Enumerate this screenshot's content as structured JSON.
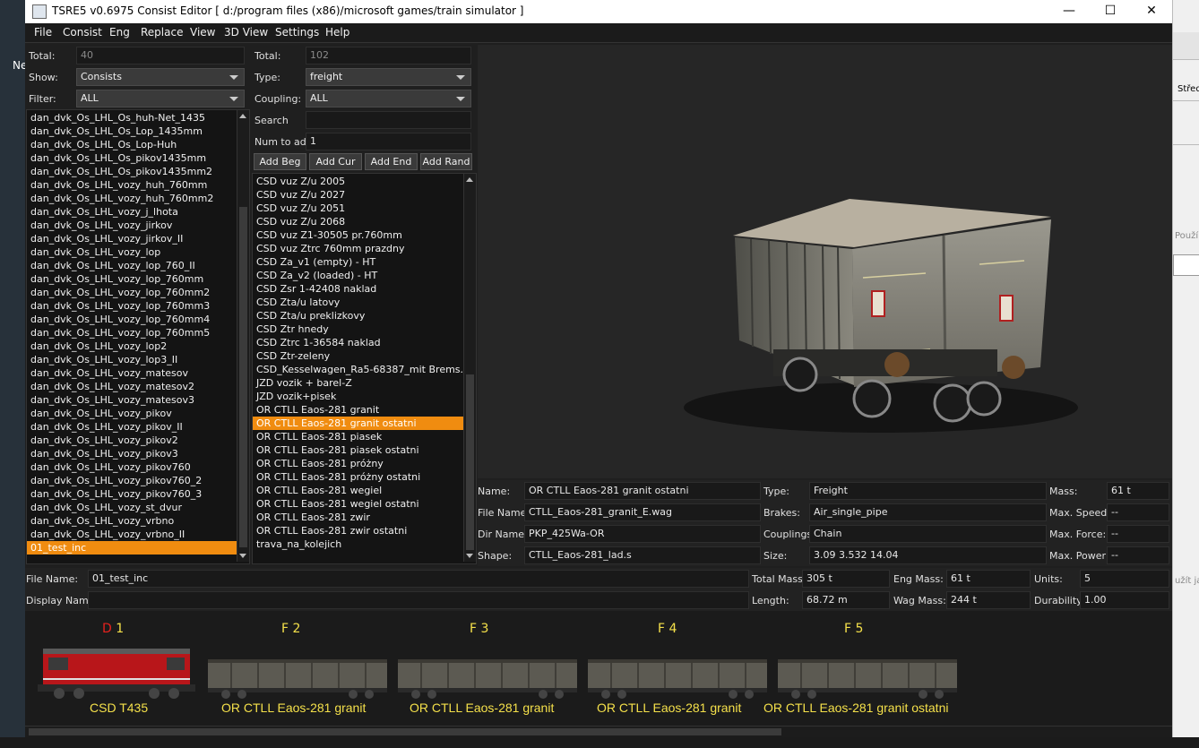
{
  "window": {
    "title": "TSRE5 v0.6975 Consist Editor   [ d:/program files (x86)/microsoft games/train simulator ]",
    "minimize": "—",
    "maximize": "☐",
    "close": "✕"
  },
  "menu": [
    "File",
    "Consist",
    "Eng",
    "Replace",
    "View",
    "3D View",
    "Settings",
    "Help"
  ],
  "left_panel": {
    "total_label": "Total:",
    "total_value": "40",
    "show_label": "Show:",
    "show_value": "Consists",
    "filter_label": "Filter:",
    "filter_value": "ALL",
    "items": [
      "dan_dvk_Os_LHL_Os_huh-Net_1435",
      "dan_dvk_Os_LHL_Os_Lop_1435mm",
      "dan_dvk_Os_LHL_Os_Lop-Huh",
      "dan_dvk_Os_LHL_Os_pikov1435mm",
      "dan_dvk_Os_LHL_Os_pikov1435mm2",
      "dan_dvk_Os_LHL_vozy_huh_760mm",
      "dan_dvk_Os_LHL_vozy_huh_760mm2",
      "dan_dvk_Os_LHL_vozy_j_lhota",
      "dan_dvk_Os_LHL_vozy_jirkov",
      "dan_dvk_Os_LHL_vozy_jirkov_II",
      "dan_dvk_Os_LHL_vozy_lop",
      "dan_dvk_Os_LHL_vozy_lop_760_II",
      "dan_dvk_Os_LHL_vozy_lop_760mm",
      "dan_dvk_Os_LHL_vozy_lop_760mm2",
      "dan_dvk_Os_LHL_vozy_lop_760mm3",
      "dan_dvk_Os_LHL_vozy_lop_760mm4",
      "dan_dvk_Os_LHL_vozy_lop_760mm5",
      "dan_dvk_Os_LHL_vozy_lop2",
      "dan_dvk_Os_LHL_vozy_lop3_II",
      "dan_dvk_Os_LHL_vozy_matesov",
      "dan_dvk_Os_LHL_vozy_matesov2",
      "dan_dvk_Os_LHL_vozy_matesov3",
      "dan_dvk_Os_LHL_vozy_pikov",
      "dan_dvk_Os_LHL_vozy_pikov_II",
      "dan_dvk_Os_LHL_vozy_pikov2",
      "dan_dvk_Os_LHL_vozy_pikov3",
      "dan_dvk_Os_LHL_vozy_pikov760",
      "dan_dvk_Os_LHL_vozy_pikov760_2",
      "dan_dvk_Os_LHL_vozy_pikov760_3",
      "dan_dvk_Os_LHL_vozy_st_dvur",
      "dan_dvk_Os_LHL_vozy_vrbno",
      "dan_dvk_Os_LHL_vozy_vrbno_II",
      "01_test_inc"
    ],
    "selected": "01_test_inc"
  },
  "mid_panel": {
    "total_label": "Total:",
    "total_value": "102",
    "type_label": "Type:",
    "type_value": "freight",
    "coupling_label": "Coupling:",
    "coupling_value": "ALL",
    "search_label": "Search",
    "search_value": "",
    "num_label": "Num to add",
    "num_value": "1",
    "buttons": [
      "Add Beg",
      "Add Cur",
      "Add End",
      "Add Rand"
    ],
    "items": [
      "CSD vuz Z/u 2005",
      "CSD vuz Z/u 2027",
      "CSD vuz Z/u 2051",
      "CSD vuz Z/u 2068",
      "CSD vuz Z1-30505 pr.760mm",
      "CSD vuz Ztrc 760mm prazdny",
      "CSD Za_v1 (empty) - HT",
      "CSD Za_v2 (loaded) - HT",
      "CSD Zsr 1-42408 naklad",
      "CSD Zta/u latovy",
      "CSD Zta/u preklizkovy",
      "CSD Ztr hnedy",
      "CSD Ztrc 1-36584 naklad",
      "CSD Ztr-zeleny",
      "CSD_Kesselwagen_Ra5-68387_mit Brems...",
      "JZD vozik + barel-Z",
      "JZD vozik+pisek",
      "OR CTLL Eaos-281 granit",
      "OR CTLL Eaos-281 granit ostatni",
      "OR CTLL Eaos-281 piasek",
      "OR CTLL Eaos-281 piasek ostatni",
      "OR CTLL Eaos-281 próżny",
      "OR CTLL Eaos-281 próżny ostatni",
      "OR CTLL Eaos-281 wegiel",
      "OR CTLL Eaos-281 wegiel ostatni",
      "OR CTLL Eaos-281 zwir",
      "OR CTLL Eaos-281 zwir ostatni",
      "trava_na_kolejich"
    ],
    "selected": "OR CTLL Eaos-281 granit ostatni"
  },
  "props": {
    "name_label": "Name:",
    "name_value": "OR CTLL Eaos-281 granit ostatni",
    "type_label": "Type:",
    "type_value": "Freight",
    "mass_label": "Mass:",
    "mass_value": "61 t",
    "file_label": "File Name:",
    "file_value": "CTLL_Eaos-281_granit_E.wag",
    "brakes_label": "Brakes:",
    "brakes_value": "Air_single_pipe",
    "maxspeed_label": "Max. Speed:",
    "maxspeed_value": "--",
    "dir_label": "Dir Name:",
    "dir_value": "PKP_425Wa-OR",
    "couplings_label": "Couplings:",
    "couplings_value": "Chain",
    "maxforce_label": "Max. Force:",
    "maxforce_value": "--",
    "shape_label": "Shape:",
    "shape_value": "CTLL_Eaos-281_lad.s",
    "size_label": "Size:",
    "size_value": "3.09 3.532 14.04",
    "maxpower_label": "Max. Power:",
    "maxpower_value": "--"
  },
  "consist_info": {
    "file_label": "File Name:",
    "file_value": "01_test_inc",
    "display_label": "Display Name:",
    "display_value": "",
    "totalmass_label": "Total Mass:",
    "totalmass_value": "305 t",
    "engmass_label": "Eng Mass:",
    "engmass_value": "61 t",
    "units_label": "Units:",
    "units_value": "5",
    "length_label": "Length:",
    "length_value": "68.72 m",
    "wagmass_label": "Wag Mass:",
    "wagmass_value": "244 t",
    "durability_label": "Durability:",
    "durability_value": "1.00"
  },
  "consist_strip": [
    {
      "code": "D",
      "num": " 1",
      "name": "CSD T435",
      "kind": "loco"
    },
    {
      "code": "F",
      "num": " 2",
      "name": "OR CTLL Eaos-281 granit",
      "kind": "wagon"
    },
    {
      "code": "F",
      "num": " 3",
      "name": "OR CTLL Eaos-281 granit",
      "kind": "wagon"
    },
    {
      "code": "F",
      "num": " 4",
      "name": "OR CTLL Eaos-281 granit",
      "kind": "wagon"
    },
    {
      "code": "F",
      "num": " 5",
      "name": "OR CTLL Eaos-281 granit ostatni",
      "kind": "wagon"
    }
  ],
  "desktop": {
    "left_text": "Ne",
    "right_text": "Středn",
    "right_text2": "Použí",
    "right_text3": "užít ja"
  },
  "colors": {
    "selection": "#f08c10",
    "strip_text": "#f4e04a",
    "loco_code": "#e8221e"
  }
}
